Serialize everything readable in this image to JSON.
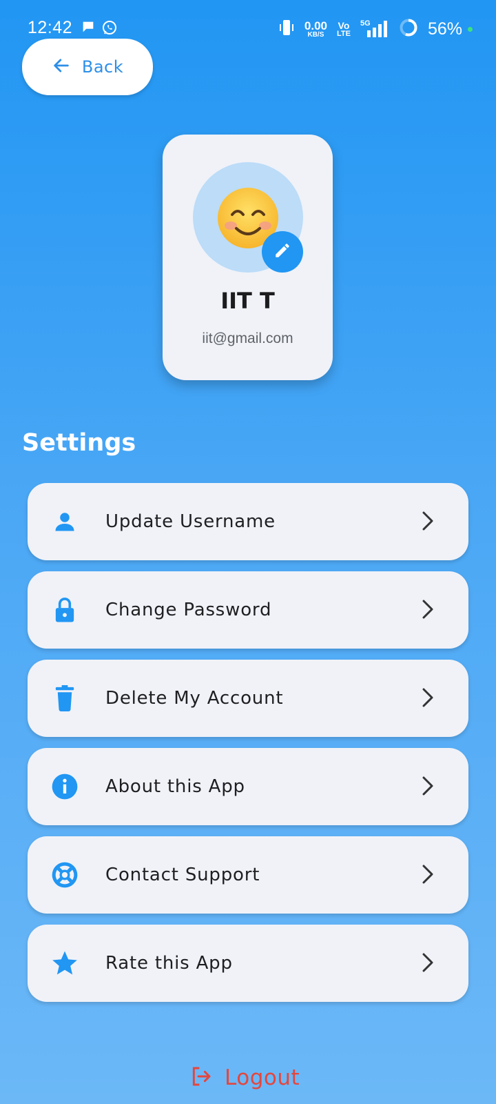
{
  "status_bar": {
    "time": "12:42",
    "net_speed_value": "0.00",
    "net_speed_unit": "KB/S",
    "volte_top": "Vo",
    "volte_bottom": "LTE",
    "network": "5G",
    "battery": "56%"
  },
  "header": {
    "back_label": "Back"
  },
  "profile": {
    "emoji": "😊",
    "name": "IIT T",
    "email": "iit@gmail.com"
  },
  "settings": {
    "title": "Settings",
    "items": [
      {
        "label": "Update Username",
        "icon": "person-icon"
      },
      {
        "label": "Change Password",
        "icon": "lock-icon"
      },
      {
        "label": "Delete My Account",
        "icon": "trash-icon"
      },
      {
        "label": "About this App",
        "icon": "info-icon"
      },
      {
        "label": "Contact Support",
        "icon": "lifebuoy-icon"
      },
      {
        "label": "Rate this App",
        "icon": "star-icon"
      }
    ]
  },
  "logout": {
    "label": "Logout"
  },
  "colors": {
    "accent": "#2196F3",
    "card": "#F0F2F8",
    "logout": "#E5463C"
  }
}
